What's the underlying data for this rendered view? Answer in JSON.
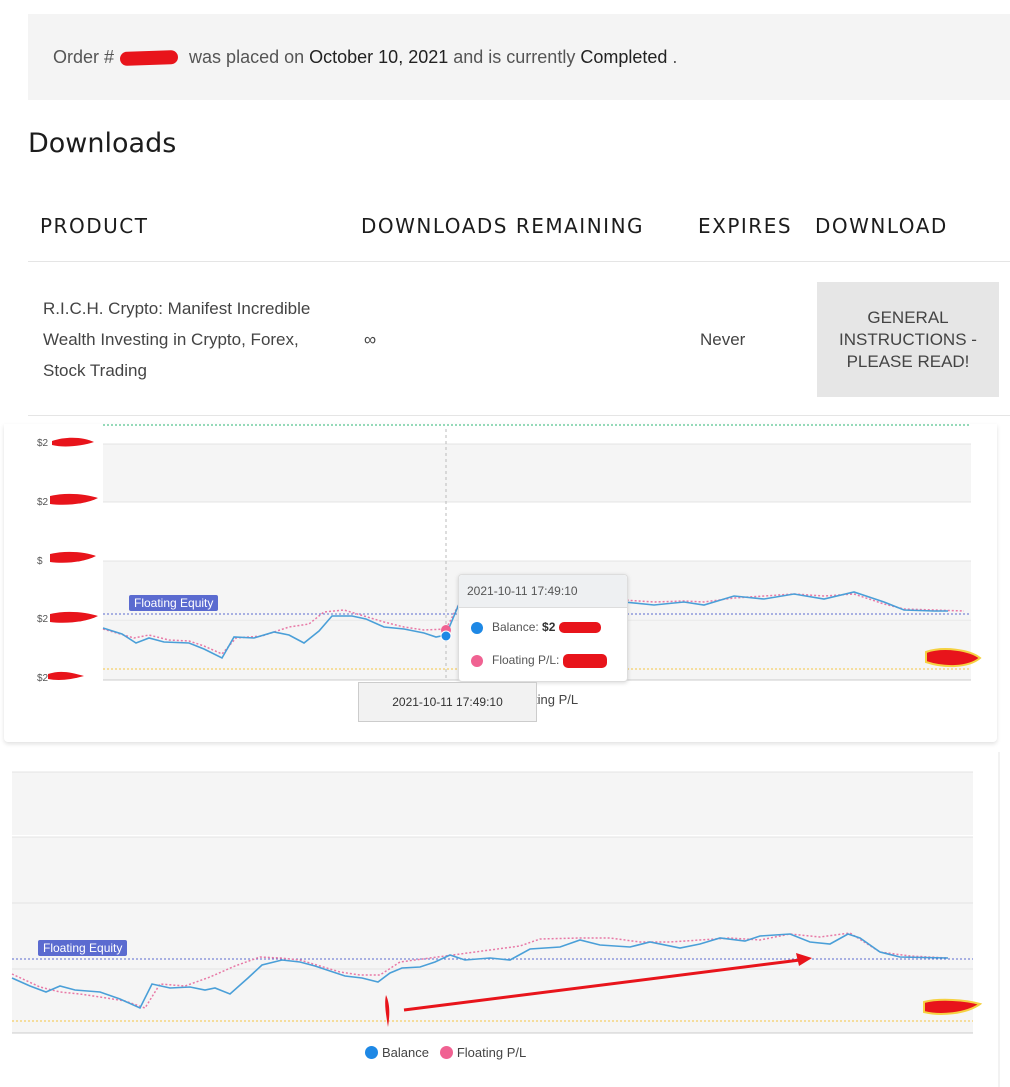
{
  "order_notice": {
    "prefix": "Order #",
    "middle": "was placed on",
    "date": "October 10, 2021",
    "status_text": "and is currently",
    "status": "Completed",
    "suffix": "."
  },
  "downloads": {
    "title": "Downloads",
    "columns": [
      "PRODUCT",
      "DOWNLOADS REMAINING",
      "EXPIRES",
      "DOWNLOAD"
    ],
    "row": {
      "product": "R.I.C.H. Crypto: Manifest Incredible Wealth Investing in Crypto, Forex, Stock Trading",
      "remaining": "∞",
      "expires": "Never",
      "button": "GENERAL INSTRUCTIONS - PLEASE READ!"
    }
  },
  "chart1": {
    "y_ticks": [
      "$2",
      "$2",
      "$",
      "$2",
      "$2"
    ],
    "floating_equity_label": "Floating Equity",
    "tooltip": {
      "time": "2021-10-11 17:49:10",
      "balance_label": "Balance:",
      "balance_value": "$2",
      "floating_label": "Floating P/L:"
    },
    "x_tooltip": "2021-10-11 17:49:10",
    "legend_partial": "ting P/L"
  },
  "chart2": {
    "floating_equity_label": "Floating Equity",
    "legend": [
      {
        "label": "Balance",
        "color": "#1e88e5"
      },
      {
        "label": "Floating P/L",
        "color": "#f06292"
      }
    ]
  },
  "colors": {
    "balance": "#4a9fd8",
    "floating": "#e879a6",
    "equity_line": "#5b6bd0",
    "annotation": "#e8141b"
  }
}
